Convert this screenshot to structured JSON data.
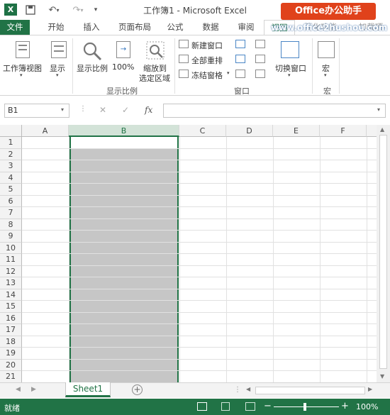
{
  "title_bar": {
    "app_icon": "excel-logo-icon",
    "title": "工作簿1 - Microsoft Excel",
    "badge": "Office办公助手"
  },
  "watermark": {
    "url": "www.office2hushou.com"
  },
  "tabs": [
    {
      "label": "文件"
    },
    {
      "label": "开始"
    },
    {
      "label": "插入"
    },
    {
      "label": "页面布局"
    },
    {
      "label": "公式"
    },
    {
      "label": "数据"
    },
    {
      "label": "审阅"
    },
    {
      "label": "视图"
    },
    {
      "label": "简化功能"
    },
    {
      "label": "加载项"
    }
  ],
  "ribbon": {
    "workbook_views": "工作簿视图",
    "show": "显示",
    "zoom": "显示比例",
    "zoom_100": "100%",
    "zoom_selection_line1": "缩放到",
    "zoom_selection_line2": "选定区域",
    "zoom_group": "显示比例",
    "new_window": "新建窗口",
    "arrange_all": "全部重排",
    "freeze_panes": "冻结窗格",
    "window_group": "窗口",
    "switch_windows": "切换窗口",
    "macros": "宏",
    "macros_group": "宏"
  },
  "formula_bar": {
    "name_box": "B1",
    "cancel": "✕",
    "enter": "✓",
    "fx": "fx",
    "value": ""
  },
  "grid": {
    "columns": [
      "A",
      "B",
      "C",
      "D",
      "E",
      "F"
    ],
    "rows": [
      "1",
      "2",
      "3",
      "4",
      "5",
      "6",
      "7",
      "8",
      "9",
      "10",
      "11",
      "12",
      "13",
      "14",
      "15",
      "16",
      "17",
      "18",
      "19",
      "20",
      "21"
    ],
    "selected_column": "B"
  },
  "sheet_tabs": {
    "active": "Sheet1"
  },
  "status": {
    "ready": "就绪",
    "zoom": "100%"
  }
}
